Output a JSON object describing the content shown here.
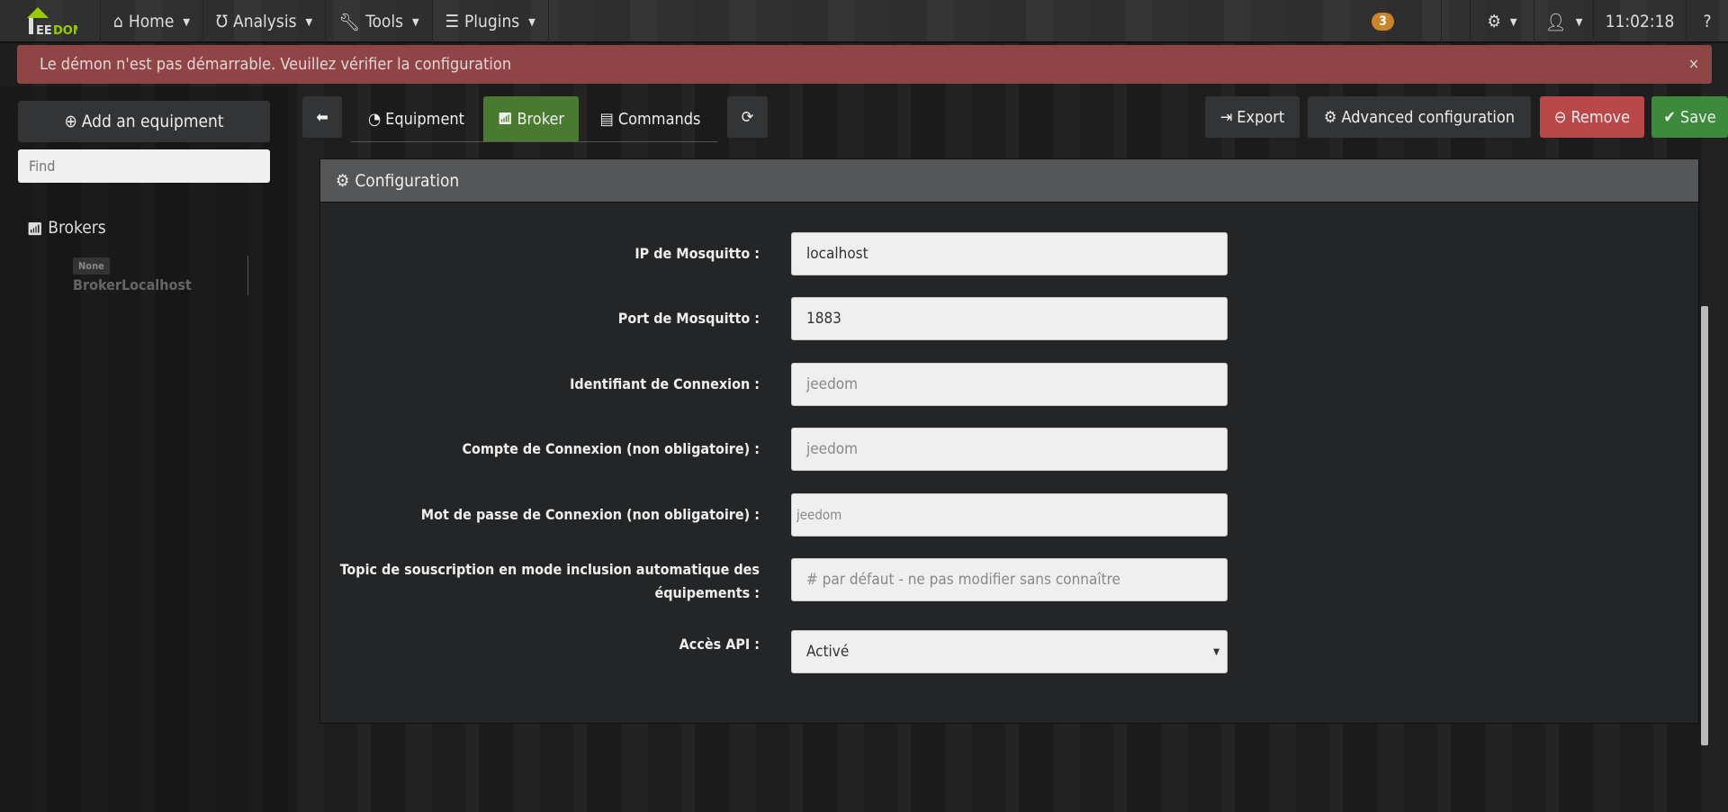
{
  "navbar": {
    "logo": "JEEDOM",
    "menu": [
      {
        "label": "Home",
        "icon": "home-icon"
      },
      {
        "label": "Analysis",
        "icon": "stethoscope-icon"
      },
      {
        "label": "Tools",
        "icon": "wrench-icon"
      },
      {
        "label": "Plugins",
        "icon": "tasks-icon"
      }
    ],
    "notification_count": "3",
    "time": "11:02:18"
  },
  "alert": {
    "message": "Le démon n'est pas démarrable. Veuillez vérifier la configuration",
    "close": "×",
    "color": "#8f4546"
  },
  "sidebar": {
    "add_label": "Add an equipment",
    "find_placeholder": "Find",
    "group": "Brokers",
    "equipment": {
      "badge": "None",
      "name": "BrokerLocalhost"
    }
  },
  "tabs": {
    "equipment": "Equipment",
    "broker": "Broker",
    "commands": "Commands",
    "active": "Broker",
    "active_color": "#4a7a2f"
  },
  "actions": {
    "export": "Export",
    "advanced": "Advanced configuration",
    "remove": "Remove",
    "save": "Save",
    "remove_color": "#b9484a",
    "save_color": "#3e8a3d"
  },
  "panel": {
    "title": "Configuration",
    "fields": [
      {
        "label": "IP de Mosquitto :",
        "value": "localhost"
      },
      {
        "label": "Port de Mosquitto :",
        "value": "1883"
      },
      {
        "label": "Identifiant de Connexion :",
        "placeholder": "jeedom"
      },
      {
        "label": "Compte de Connexion (non obligatoire) :",
        "placeholder": "jeedom"
      },
      {
        "label": "Mot de passe de Connexion (non obligatoire) :",
        "placeholder": "jeedom"
      },
      {
        "label": "Topic de souscription en mode inclusion automatique des équipements :",
        "placeholder": "# par défaut - ne pas modifier sans connaître"
      },
      {
        "label": "Accès API :",
        "value": "Activé"
      }
    ]
  }
}
